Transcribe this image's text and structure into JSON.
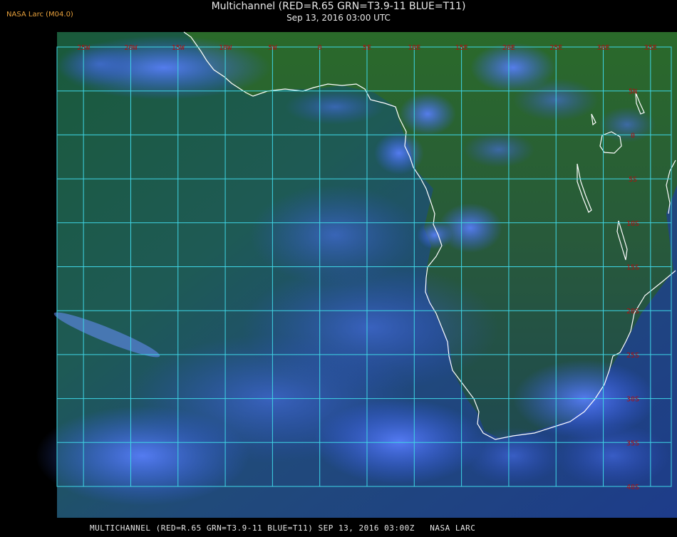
{
  "header": {
    "badge": "NASA Larc (M04.0)",
    "title": "Multichannel (RED=R.65 GRN=T3.9-11 BLUE=T11)",
    "subtitle": "Sep 13, 2016 03:00 UTC"
  },
  "map": {
    "longitude_labels": [
      "25W",
      "20W",
      "15W",
      "10W",
      "5W",
      "0",
      "5E",
      "10E",
      "15E",
      "20E",
      "25E",
      "30E",
      "35E"
    ],
    "latitude_labels": [
      "5N",
      "0",
      "5S",
      "10S",
      "15S",
      "20S",
      "25S",
      "30S",
      "35S",
      "40S"
    ],
    "colors": {
      "grid": "#3fd6e6",
      "coast": "#ffffff",
      "grid_label": "#b01010",
      "ocean_base": "#1f4a72",
      "land_base": "#2a5a2a",
      "cloud": "#3a6cff"
    }
  },
  "footer": {
    "text": "MULTICHANNEL (RED=R.65 GRN=T3.9-11 BLUE=T11) SEP 13, 2016 03:00Z   NASA LARC"
  }
}
